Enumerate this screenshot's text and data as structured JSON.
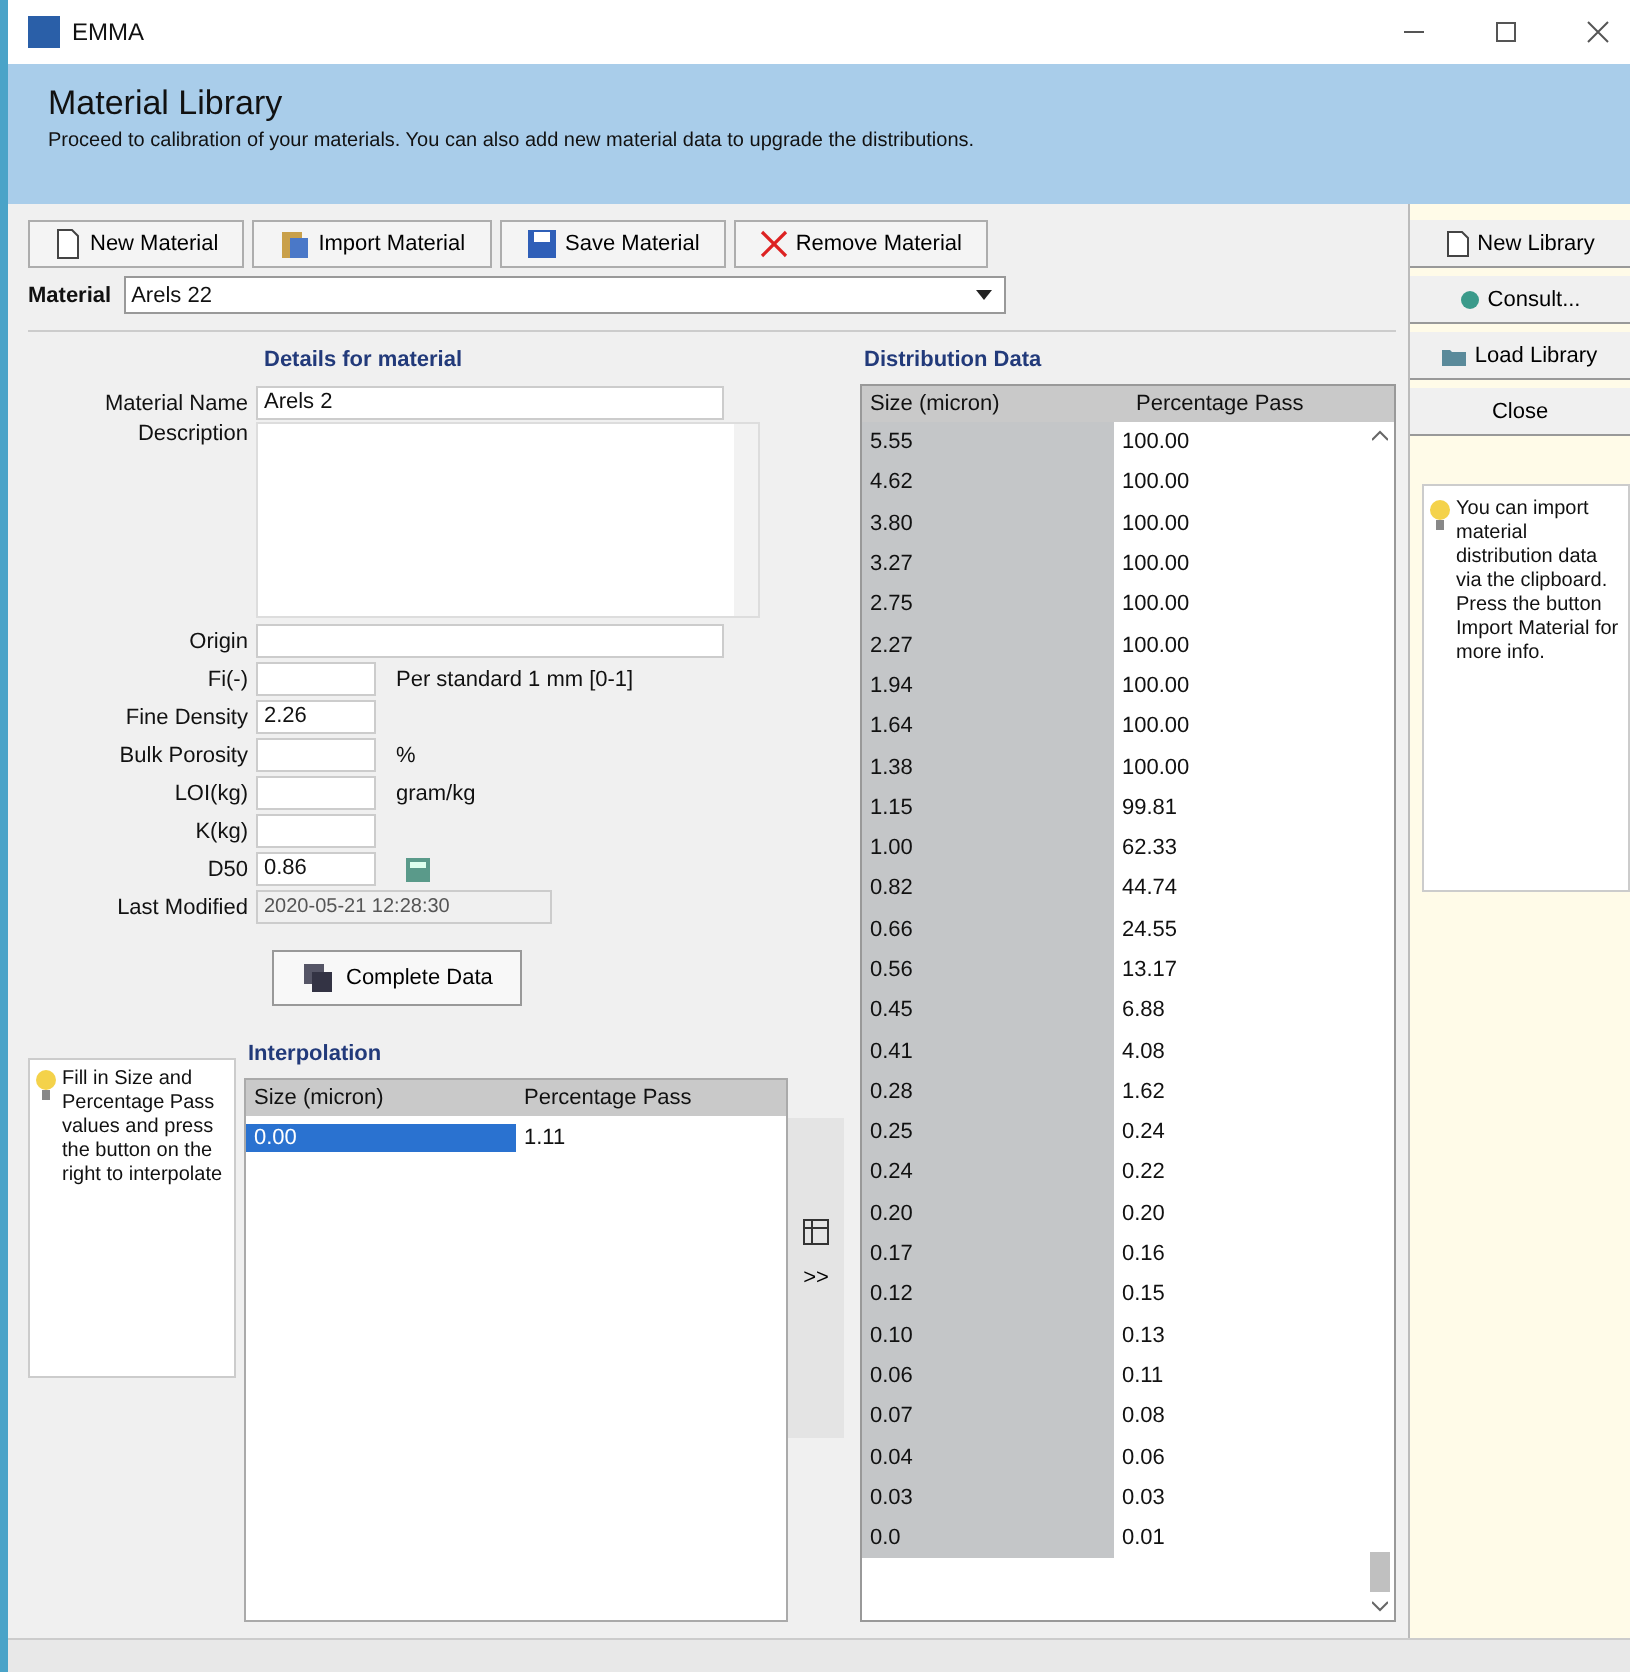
{
  "window": {
    "title": "EMMA"
  },
  "header": {
    "title": "Material Library",
    "subtitle": "Proceed to calibration of your materials. You can also add new material data to upgrade the distributions."
  },
  "toolbar": [
    {
      "label": "New Material",
      "kind": "new"
    },
    {
      "label": "Import Material",
      "kind": "import"
    },
    {
      "label": "Save Material",
      "kind": "save"
    },
    {
      "label": "Remove Material",
      "kind": "remove"
    }
  ],
  "material": {
    "label": "Material",
    "value": "Arels 22"
  },
  "details": {
    "title": "Details for material",
    "fields": [
      {
        "label": "Material Name",
        "value": "Arels 2",
        "kind": "wide"
      },
      {
        "label": "Description",
        "kind": "area"
      },
      {
        "label": "Origin",
        "kind": "wide"
      },
      {
        "label": "Fi(-)",
        "kind": "short",
        "unit": "Per standard 1 mm [0-1]"
      },
      {
        "label": "Fine Density",
        "value": "2.26",
        "kind": "short"
      },
      {
        "label": "Bulk Porosity",
        "kind": "short",
        "unit": "%"
      },
      {
        "label": "LOI(kg)",
        "kind": "short",
        "unit": "gram/kg"
      },
      {
        "label": "K(kg)",
        "kind": "short"
      },
      {
        "label": "D50",
        "value": "0.86",
        "kind": "calc"
      },
      {
        "label": "Last Modified",
        "value": "2020-05-21 12:28:30",
        "kind": "readonly"
      }
    ],
    "complete_button": "Complete Data"
  },
  "interpolation": {
    "tip": "Fill in Size and Percentage Pass values and press the button on the right to interpolate",
    "title": "Interpolation",
    "columns": [
      "Size (micron)",
      "Percentage Pass"
    ],
    "rows": [
      {
        "cells": [
          "0.00",
          "1.11"
        ],
        "selected": true
      }
    ],
    "side_button": ">>"
  },
  "distribution": {
    "title": "Distribution Data",
    "columns": [
      "Size (micron)",
      "Percentage Pass"
    ],
    "rows": [
      [
        "5.55",
        "100.00"
      ],
      [
        "4.62",
        "100.00"
      ],
      [
        "3.80",
        "100.00"
      ],
      [
        "3.27",
        "100.00"
      ],
      [
        "2.75",
        "100.00"
      ],
      [
        "2.27",
        "100.00"
      ],
      [
        "1.94",
        "100.00"
      ],
      [
        "1.64",
        "100.00"
      ],
      [
        "1.38",
        "100.00"
      ],
      [
        "1.15",
        "99.81"
      ],
      [
        "1.00",
        "62.33"
      ],
      [
        "0.82",
        "44.74"
      ],
      [
        "0.66",
        "24.55"
      ],
      [
        "0.56",
        "13.17"
      ],
      [
        "0.45",
        "6.88"
      ],
      [
        "0.41",
        "4.08"
      ],
      [
        "0.28",
        "1.62"
      ],
      [
        "0.25",
        "0.24"
      ],
      [
        "0.24",
        "0.22"
      ],
      [
        "0.20",
        "0.20"
      ],
      [
        "0.17",
        "0.16"
      ],
      [
        "0.12",
        "0.15"
      ],
      [
        "0.10",
        "0.13"
      ],
      [
        "0.06",
        "0.11"
      ],
      [
        "0.07",
        "0.08"
      ],
      [
        "0.04",
        "0.06"
      ],
      [
        "0.03",
        "0.03"
      ],
      [
        "0.0",
        "0.01"
      ]
    ]
  },
  "library_buttons": [
    {
      "label": "New Library",
      "kind": "new"
    },
    {
      "label": "Consult...",
      "kind": "consult"
    },
    {
      "label": "Load Library",
      "kind": "load"
    },
    {
      "label": "Close",
      "kind": "plain"
    }
  ],
  "library_tip": "You can import material distribution data via the clipboard. Press the button Import Material for more info."
}
